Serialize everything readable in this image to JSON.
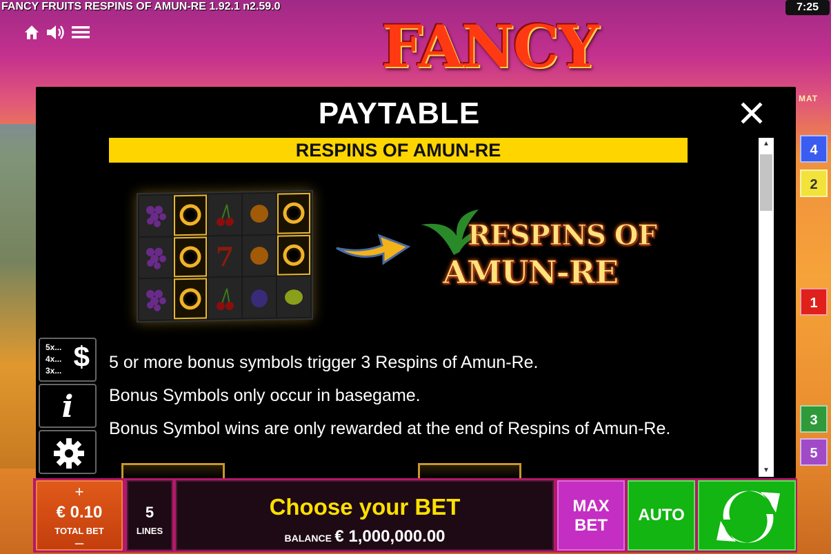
{
  "header": {
    "game_version": "FANCY FRUITS RESPINS OF AMUN-RE 1.92.1 n2.59.0",
    "time": "7:25",
    "icons": [
      "home-icon",
      "sound-icon",
      "menu-icon"
    ]
  },
  "logo": {
    "text": "FANCY FRUITS"
  },
  "background": {
    "right_label": "MAT",
    "line_markers": [
      {
        "label": "4",
        "color": "#3a5cf0"
      },
      {
        "label": "2",
        "color": "#f2e23a"
      },
      {
        "label": "1",
        "color": "#e0201a"
      },
      {
        "label": "3",
        "color": "#2e9a3a"
      },
      {
        "label": "5",
        "color": "#a04ac8"
      }
    ]
  },
  "paytable": {
    "title": "PAYTABLE",
    "section_title": "RESPINS OF AMUN-RE",
    "feature_logo_line1": "RESPINS OF",
    "feature_logo_line2": "AMUN-RE",
    "lines": [
      "5 or more bonus symbols trigger 3 Respins of Amun-Re.",
      "Bonus Symbols only occur in basegame.",
      "Bonus Symbol wins are only rewarded at the end of Respins of Amun-Re."
    ],
    "reel_symbols": [
      [
        "grapes",
        "bonus",
        "cherry",
        "orange",
        "bonus"
      ],
      [
        "grapes",
        "bonus",
        "seven",
        "orange",
        "bonus"
      ],
      [
        "grapes",
        "bonus",
        "cherry",
        "plum",
        "lemon"
      ]
    ]
  },
  "side_buttons": {
    "multipliers": [
      "5x...",
      "4x...",
      "3x..."
    ],
    "dollar_symbol": "$",
    "info_symbol": "i"
  },
  "controls": {
    "total_bet_value": "€ 0.10",
    "total_bet_label": "TOTAL BET",
    "plus": "+",
    "minus": "–",
    "lines_value": "5",
    "lines_label": "LINES",
    "choose_bet": "Choose your BET",
    "balance_label": "BALANCE",
    "balance_value": "€ 1,000,000.00",
    "max_bet_line1": "MAX",
    "max_bet_line2": "BET",
    "auto": "AUTO"
  },
  "colors": {
    "accent_yellow": "#ffd500",
    "total_bet_orange": "#d04a12",
    "max_bet_purple": "#c42ec2",
    "auto_green": "#12b512",
    "panel_magenta": "#b2196a"
  }
}
